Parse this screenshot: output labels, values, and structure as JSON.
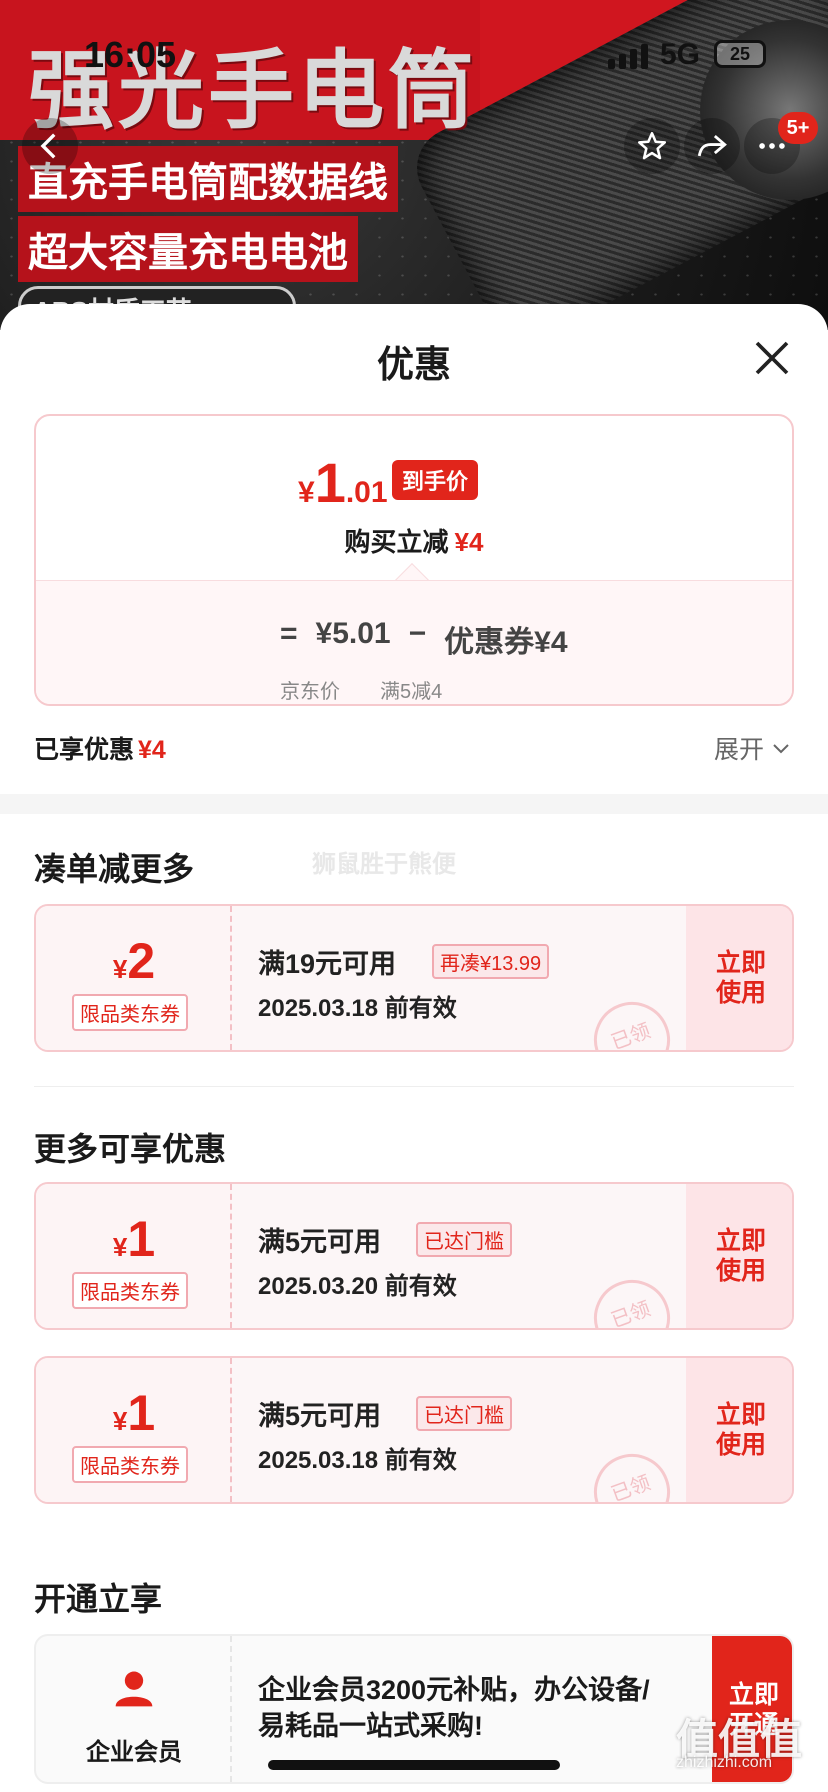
{
  "hero": {
    "title": "强光手电筒",
    "line1": "直充手电筒配数据线",
    "line2": "超大容量充电电池",
    "pill": "ABS材质工艺"
  },
  "status_bar": {
    "time": "16:05",
    "network": "5G",
    "battery": "25"
  },
  "nav": {
    "badge": "5+"
  },
  "sheet": {
    "title": "优惠",
    "final_price": {
      "yen": "¥",
      "int": "1",
      "dec": ".01",
      "tag": "到手价"
    },
    "save_text": "购买立减",
    "save_amount": "¥4",
    "formula": {
      "eq": "=",
      "jd_price": "¥5.01",
      "minus": "−",
      "coupon_label": "优惠券¥4",
      "jd_label": "京东价",
      "coupon_rule": "满5减4"
    },
    "enjoyed_label": "已享优惠",
    "enjoyed_amount": "¥4",
    "expand_label": "展开"
  },
  "watermark": "狮鼠胜于熊便",
  "sections": {
    "combine": "凑单减更多",
    "more": "更多可享优惠",
    "open": "开通立享"
  },
  "coupons": [
    {
      "yen": "¥",
      "amount": "2",
      "type": "限品类东券",
      "condition": "满19元可用",
      "chip": "再凑¥13.99",
      "date": "2025.03.18 前有效",
      "stamp": "已领",
      "use1": "立即",
      "use2": "使用"
    },
    {
      "yen": "¥",
      "amount": "1",
      "type": "限品类东券",
      "condition": "满5元可用",
      "chip": "已达门槛",
      "date": "2025.03.20 前有效",
      "stamp": "已领",
      "use1": "立即",
      "use2": "使用"
    },
    {
      "yen": "¥",
      "amount": "1",
      "type": "限品类东券",
      "condition": "满5元可用",
      "chip": "已达门槛",
      "date": "2025.03.18 前有效",
      "stamp": "已领",
      "use1": "立即",
      "use2": "使用"
    }
  ],
  "member": {
    "label": "企业会员",
    "text": "企业会员3200元补贴，办公设备/易耗品一站式采购!",
    "btn1": "立即",
    "btn2": "开通"
  },
  "site": {
    "mark": "值值值",
    "url": "zhizhizhi.com"
  },
  "colors": {
    "accent": "#e1251b",
    "coupon_bg": "#fdf4f5"
  }
}
